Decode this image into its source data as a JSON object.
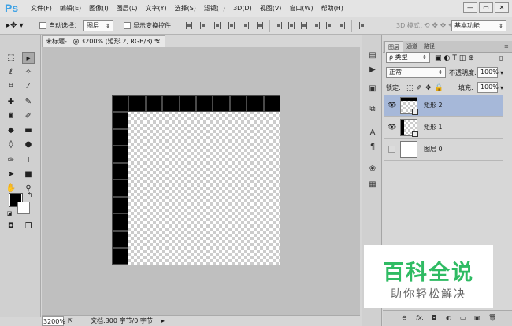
{
  "app": {
    "logo": "Ps"
  },
  "menu": {
    "items": [
      "文件(F)",
      "编辑(E)",
      "图像(I)",
      "图层(L)",
      "文字(Y)",
      "选择(S)",
      "滤镜(T)",
      "3D(D)",
      "视图(V)",
      "窗口(W)",
      "帮助(H)"
    ]
  },
  "window_controls": {
    "minimize": "—",
    "restore": "▭",
    "close": "✕"
  },
  "options": {
    "auto_select_label": "自动选择：",
    "auto_select_value": "图层",
    "show_transform_label": "显示变换控件",
    "mode_3d_label": "3D 模式：",
    "workspace_value": "基本功能"
  },
  "document": {
    "tab_title": "未标题-1 @ 3200% (矩形 2, RGB/8) *",
    "tab_close": "×",
    "zoom": "3200%",
    "info": "文档:300 字节/0 字节"
  },
  "panel": {
    "tabs": [
      "图层",
      "通道",
      "路径"
    ],
    "filter_kind": "ρ 类型",
    "blend_mode": "正常",
    "opacity_label": "不透明度:",
    "opacity_value": "100%",
    "lock_label": "锁定:",
    "fill_label": "填充:",
    "fill_value": "100%",
    "layers": [
      {
        "name": "矩形 2",
        "visible": true,
        "selected": true
      },
      {
        "name": "矩形 1",
        "visible": true,
        "selected": false
      },
      {
        "name": "图层 0",
        "visible": false,
        "selected": false
      }
    ],
    "footer_fx": "fx."
  },
  "watermark": {
    "title": "百科全说",
    "subtitle": "助你轻松解决",
    "color": "#2fbb63"
  },
  "colors": {
    "foreground": "#000000",
    "background": "#ffffff",
    "accent": "#3ea2e5",
    "selected_layer": "#a6b8d9"
  }
}
